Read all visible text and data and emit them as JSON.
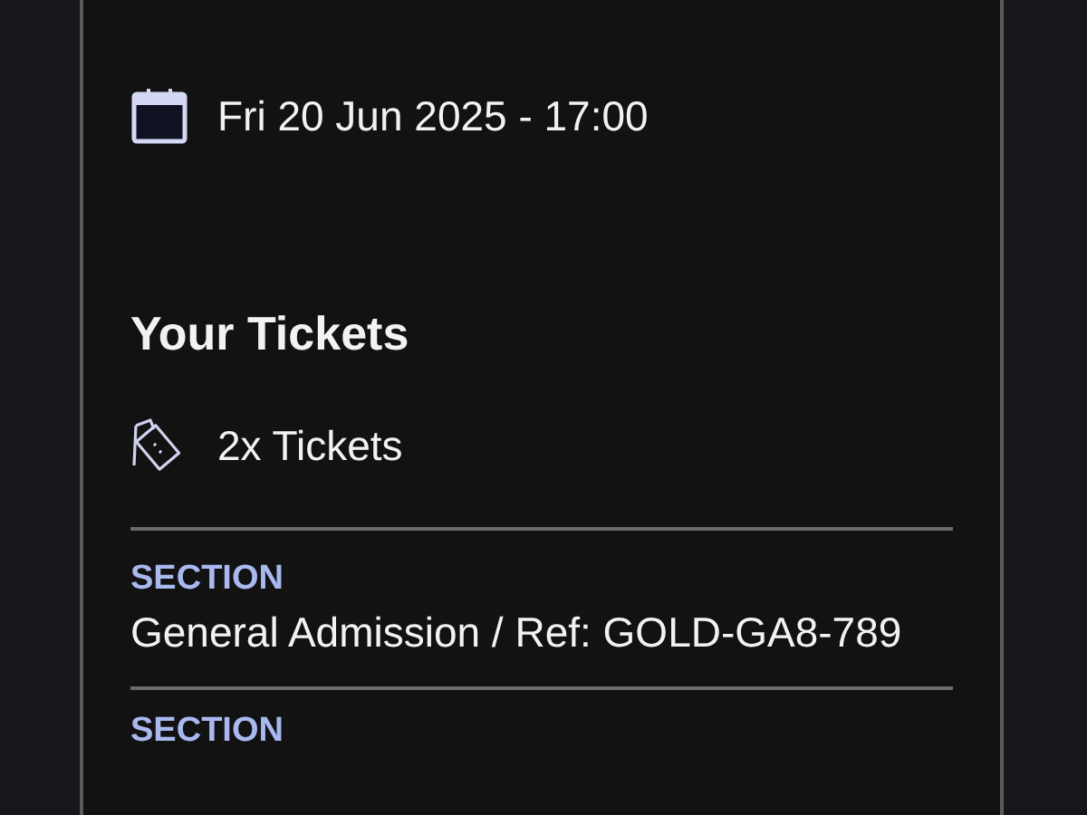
{
  "event": {
    "date_time": "Fri 20 Jun 2025 - 17:00"
  },
  "tickets": {
    "heading": "Your Tickets",
    "quantity": "2x Tickets",
    "sections": [
      {
        "label": "SECTION",
        "value": "General Admission / Ref: GOLD-GA8-789"
      },
      {
        "label": "SECTION"
      }
    ]
  }
}
